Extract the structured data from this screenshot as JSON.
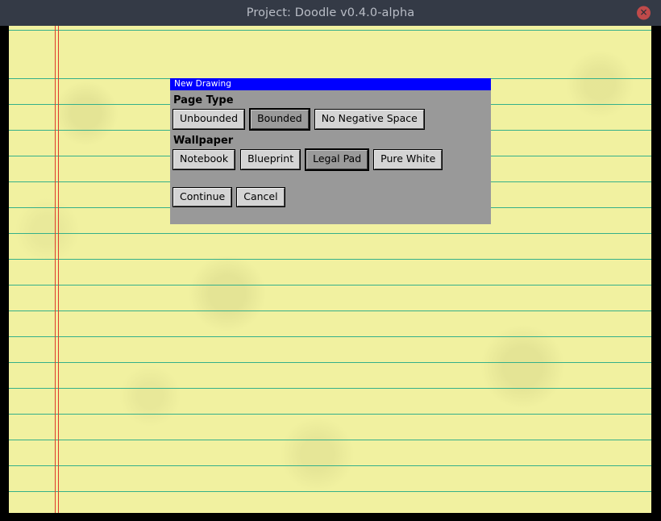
{
  "window": {
    "title": "Project: Doodle v0.4.0-alpha",
    "close_icon": "close-icon",
    "close_glyph": "✕",
    "titlebar_color": "#343a46",
    "titlebar_text_color": "#b9bdc6",
    "close_button_color": "#c04a4a"
  },
  "canvas": {
    "wallpaper": "Legal Pad",
    "paper_color": "#f1f1a0",
    "rule_color": "#35b08a",
    "margin_line_color": "#e03b2c",
    "rule_spacing_px": 32,
    "margin_line_count": 2
  },
  "dialog": {
    "title": "New Drawing",
    "title_bar_color": "#0000ff",
    "title_text_color": "#ffffff",
    "background_color": "#999999",
    "sections": [
      {
        "heading": "Page Type",
        "options": [
          {
            "label": "Unbounded",
            "selected": false
          },
          {
            "label": "Bounded",
            "selected": true
          },
          {
            "label": "No Negative Space",
            "selected": false
          }
        ]
      },
      {
        "heading": "Wallpaper",
        "options": [
          {
            "label": "Notebook",
            "selected": false
          },
          {
            "label": "Blueprint",
            "selected": false
          },
          {
            "label": "Legal Pad",
            "selected": true
          },
          {
            "label": "Pure White",
            "selected": false
          }
        ]
      }
    ],
    "actions": [
      {
        "label": "Continue"
      },
      {
        "label": "Cancel"
      }
    ]
  }
}
